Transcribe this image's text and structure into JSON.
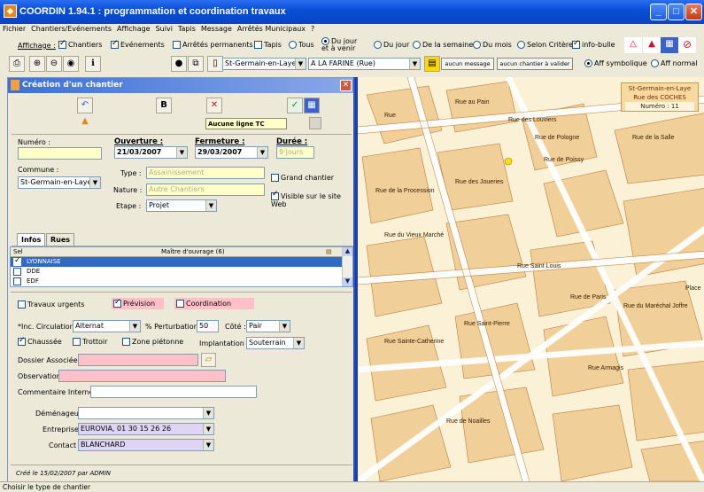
{
  "window": {
    "title": "COORDIN 1.94.1 : programmation et coordination travaux",
    "min": "_",
    "max": "□",
    "close": "✕"
  },
  "menu": [
    "Fichier",
    "Chantiers/Evénements",
    "Affichage",
    "Suivi",
    "Tapis",
    "Message",
    "Arrêtés Municipaux",
    "?"
  ],
  "display_bar": {
    "label": "Affichage :",
    "checks": [
      {
        "label": "Chantiers",
        "checked": true
      },
      {
        "label": "Evénements",
        "checked": true
      },
      {
        "label": "Arrêtés permanents",
        "checked": false
      },
      {
        "label": "Tapis",
        "checked": false
      }
    ],
    "radios": [
      {
        "label": "Tous",
        "checked": false
      },
      {
        "label": "Du jour et à venir",
        "checked": true
      },
      {
        "label": "Du jour",
        "checked": false
      },
      {
        "label": "De la semaine",
        "checked": false
      },
      {
        "label": "Du mois",
        "checked": false
      },
      {
        "label": "Selon Critères",
        "checked": false
      }
    ],
    "infobulle": {
      "label": "info-bulle",
      "checked": true
    }
  },
  "toolbar": {
    "commune": "St-Germain-en-Laye",
    "street": "A LA FARINE (Rue)",
    "no_message": "aucun message",
    "no_site": "aucun chantier à valider",
    "aff_symbolique": "Aff symbolique",
    "aff_normal": "Aff normal"
  },
  "dialog": {
    "title": "Création d'un chantier",
    "b_label": "B",
    "no_tc": "Aucune ligne TC",
    "numero_label": "Numéro :",
    "numero": "",
    "ouverture_label": "Ouverture :",
    "ouverture": "21/03/2007",
    "fermeture_label": "Fermeture :",
    "fermeture": "29/03/2007",
    "duree_label": "Durée :",
    "duree": "9 jours",
    "commune_label": "Commune :",
    "commune": "St-Germain-en-Laye",
    "type_label": "Type :",
    "type": "Assainissement",
    "nature_label": "Nature :",
    "nature": "Autre Chantiers",
    "etape_label": "Etape :",
    "etape": "Projet",
    "grand_chantier": {
      "label": "Grand chantier",
      "checked": false
    },
    "visible_web": {
      "label": "Visible sur le site Web",
      "checked": true
    },
    "tabs": [
      "Infos",
      "Rues"
    ],
    "grid": {
      "col_sel": "Sel",
      "col_maitre": "Maître d'ouvrage (6)",
      "rows": [
        {
          "checked": true,
          "name": "LYONNAISE",
          "selected": true
        },
        {
          "checked": false,
          "name": "DDE",
          "selected": false
        },
        {
          "checked": false,
          "name": "EDF",
          "selected": false
        }
      ]
    },
    "travaux_urgents": {
      "label": "Travaux urgents",
      "checked": false
    },
    "prevision": {
      "label": "Prévision",
      "checked": true
    },
    "coordination": {
      "label": "Coordination",
      "checked": false
    },
    "inc_circ_label": "*Inc. Circulation :",
    "inc_circ": "Alternat",
    "perturbation_label": "% Perturbation :",
    "perturbation": "50",
    "cote_label": "Côté :",
    "cote": "Pair",
    "chaussee": {
      "label": "Chaussée",
      "checked": true
    },
    "trottoir": {
      "label": "Trottoir",
      "checked": false
    },
    "zone_pietonne": {
      "label": "Zone piétonne",
      "checked": false
    },
    "implantation_label": "Implantation :",
    "implantation": "Souterrain",
    "dossier_label": "Dossier Associée :",
    "observation_label": "Observation :",
    "commentaire_label": "Commentaire Internet :",
    "demenageur_label": "Déménageur :",
    "demenageur": "",
    "entreprise_label": "Entreprise :",
    "entreprise": "EUROVIA, 01 30 15 26 26",
    "contact_label": "Contact :",
    "contact": "BLANCHARD",
    "footer": "Créé le 15/02/2007 par ADMIN"
  },
  "map": {
    "info_city": "St-Germain-en-Laye",
    "info_street": "Rue des COCHES",
    "info_num": "Numéro : 11",
    "labels": [
      "Rue",
      "Rue au Pain",
      "Rue de Pologne",
      "Rue des Louviers",
      "Rue de la Salle",
      "Rue de Poissy",
      "Rue de la Procession",
      "Rue des Joueries",
      "Rue du Vieux Marché",
      "Rue Saint-Pierre",
      "Rue de Paris",
      "Place",
      "Rue Saint Louis",
      "Rue du Maréchal Joffre",
      "Rue Armagis",
      "Rue de Noailles",
      "Rue Sainte-Catherine"
    ]
  },
  "status": "Choisir le type de chantier",
  "colors": {
    "title_bar": "#0a4fd6",
    "map_bg": "#fbf1d6",
    "building": "#f1cf98",
    "pink_field": "#ffc0c8"
  }
}
